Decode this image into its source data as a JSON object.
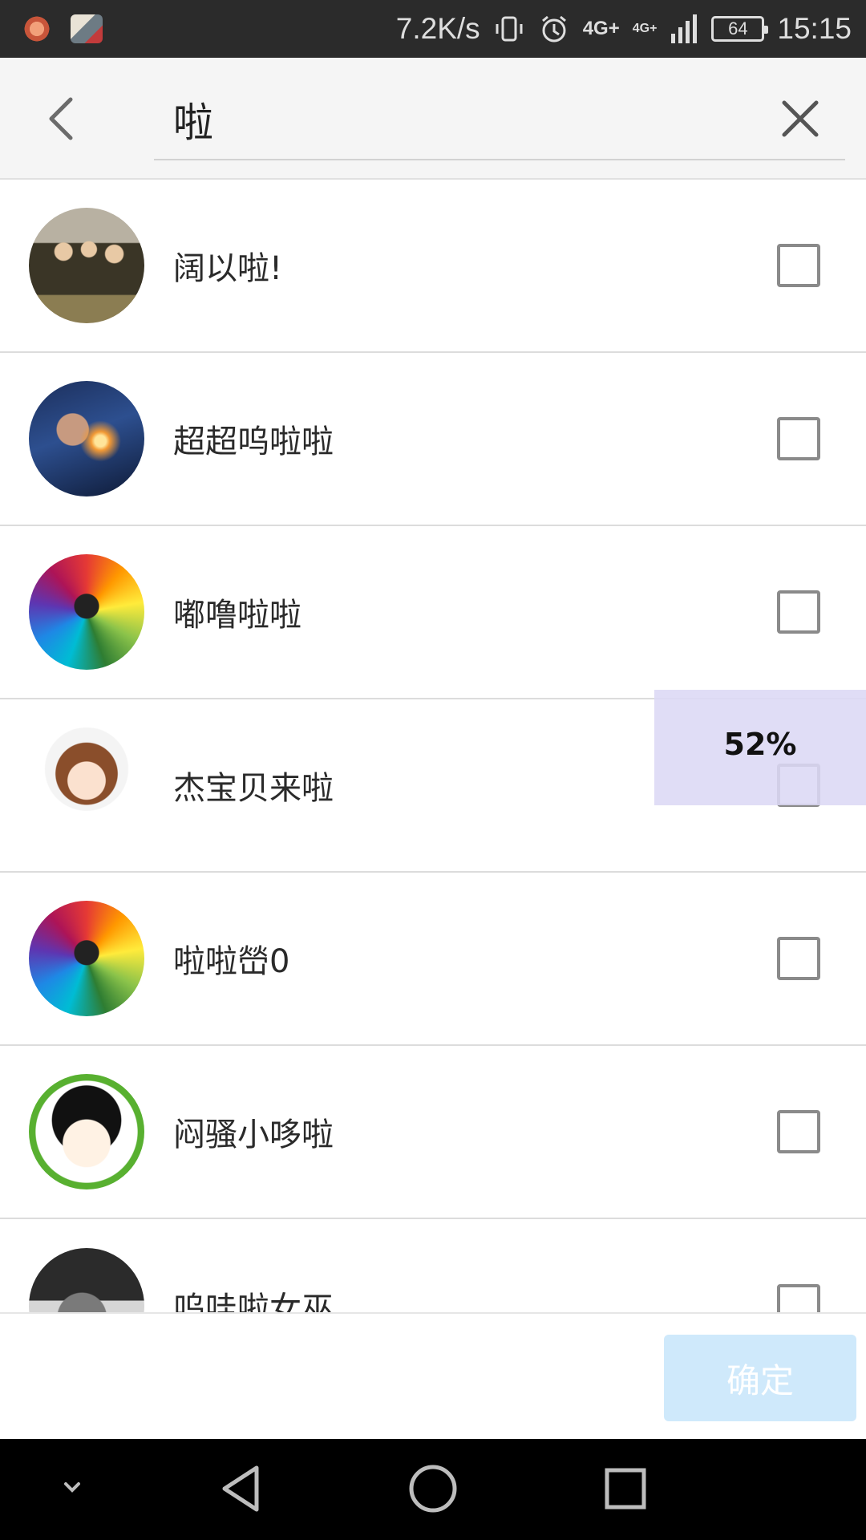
{
  "status_bar": {
    "net_speed": "7.2K/s",
    "network_1": "4G+",
    "network_2": "4G+",
    "battery": "64",
    "time": "15:15"
  },
  "search": {
    "query": "啦"
  },
  "contacts": [
    {
      "name": "阔以啦!",
      "avatar": "group-photo",
      "checked": false
    },
    {
      "name": "超超呜啦啦",
      "avatar": "space-portrait",
      "checked": false
    },
    {
      "name": "嘟噜啦啦",
      "avatar": "colored-pencils",
      "checked": false
    },
    {
      "name": "杰宝贝来啦",
      "avatar": "cartoon-girl",
      "checked": false
    },
    {
      "name": "啦啦嵤0",
      "avatar": "colored-pencils",
      "checked": false
    },
    {
      "name": "闷骚小哆啦",
      "avatar": "cartoon-boy",
      "checked": false
    },
    {
      "name": "呜哇啦女巫",
      "avatar": "bw-portrait",
      "checked": false
    }
  ],
  "progress": {
    "label": "52%",
    "value": 0.52
  },
  "actions": {
    "confirm_label": "确定"
  },
  "colors": {
    "status_bar_bg": "#2b2b2b",
    "header_bg": "#f5f5f5",
    "confirm_bg": "#cfe9fb",
    "overlay_bg": "#dcd8f5",
    "nav_bar_bg": "#000000"
  }
}
